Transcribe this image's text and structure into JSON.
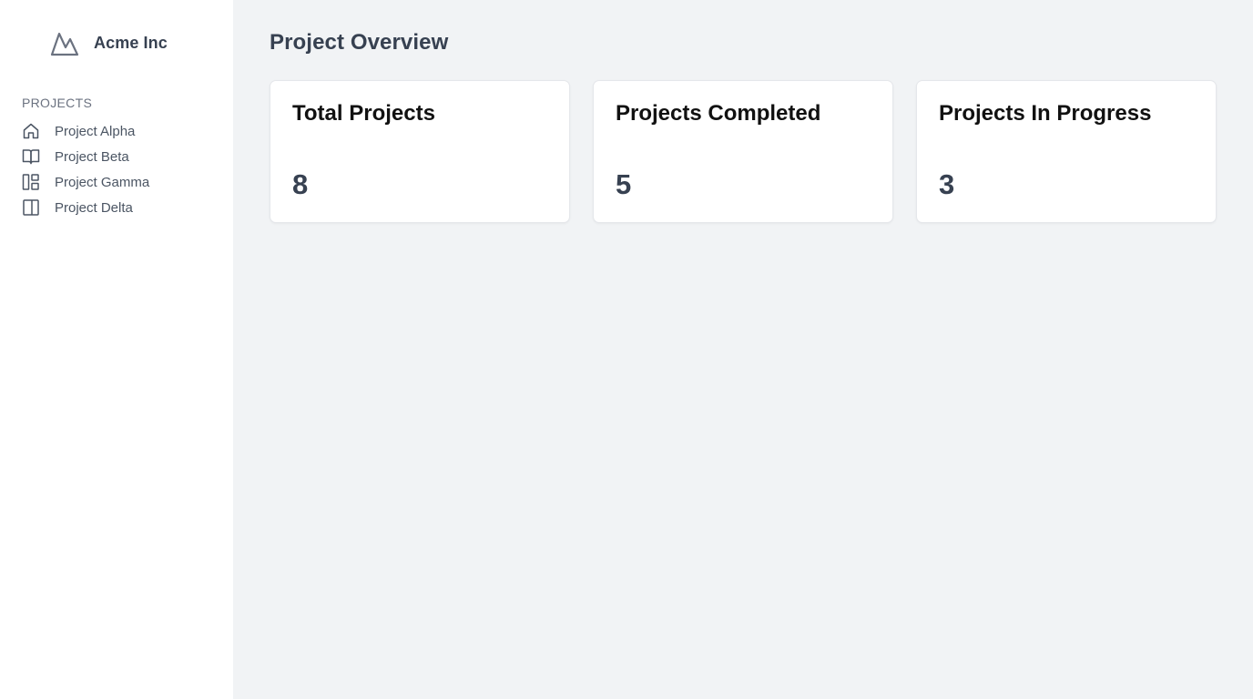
{
  "sidebar": {
    "brand": {
      "logo_icon": "mountain-icon",
      "name": "Acme Inc"
    },
    "section_heading": "PROJECTS",
    "items": [
      {
        "label": "Project Alpha",
        "icon": "home-icon"
      },
      {
        "label": "Project Beta",
        "icon": "book-open-icon"
      },
      {
        "label": "Project Gamma",
        "icon": "layout-icon"
      },
      {
        "label": "Project Delta",
        "icon": "panel-icon"
      }
    ]
  },
  "main": {
    "title": "Project Overview",
    "cards": [
      {
        "title": "Total Projects",
        "value": "8"
      },
      {
        "title": "Projects Completed",
        "value": "5"
      },
      {
        "title": "Projects In Progress",
        "value": "3"
      }
    ]
  },
  "colors": {
    "sidebar_bg": "#ffffff",
    "main_bg": "#f1f3f5",
    "card_bg": "#ffffff",
    "heading_text": "#374151",
    "muted_text": "#6b7280"
  }
}
